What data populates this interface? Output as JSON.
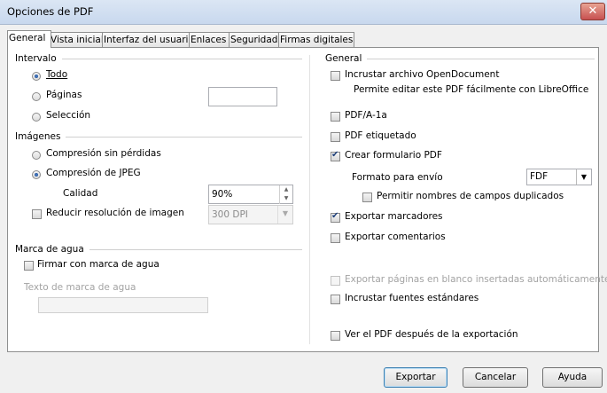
{
  "window": {
    "title": "Opciones de PDF",
    "close": "✕"
  },
  "tabs": [
    "General",
    "Vista inicial",
    "Interfaz del usuario",
    "Enlaces",
    "Seguridad",
    "Firmas digitales"
  ],
  "left": {
    "range": {
      "heading": "Intervalo",
      "all": "Todo",
      "pages": "Páginas",
      "pages_value": "",
      "selection": "Selección",
      "selected": "Todo"
    },
    "images": {
      "heading": "Imágenes",
      "lossless": "Compresión sin pérdidas",
      "jpeg": "Compresión de JPEG",
      "selected": "Compresión de JPEG",
      "quality_label": "Calidad",
      "quality_value": "90%",
      "reduce_label": "Reducir resolución de imagen",
      "reduce_checked": false,
      "resolution_value": "300 DPI"
    },
    "watermark": {
      "heading": "Marca de agua",
      "sign_label": "Firmar con marca de agua",
      "sign_checked": false,
      "text_label": "Texto de marca de agua",
      "text_value": ""
    }
  },
  "right": {
    "heading": "General",
    "embed_od": "Incrustar archivo OpenDocument",
    "embed_od_hint": "Permite editar este PDF fácilmente con LibreOffice",
    "pdfa": "PDF/A-1a",
    "tagged": "PDF etiquetado",
    "create_form": "Crear formulario PDF",
    "submit_format_label": "Formato para envío",
    "submit_format_value": "FDF",
    "allow_duplicates": "Permitir nombres de campos duplicados",
    "export_bookmarks": "Exportar marcadores",
    "export_comments": "Exportar comentarios",
    "export_blank": "Exportar páginas en blanco insertadas automáticamente",
    "embed_fonts": "Incrustar fuentes estándares",
    "view_after": "Ver el PDF después de la exportación",
    "checked": {
      "create_form": true,
      "export_bookmarks": true
    }
  },
  "buttons": {
    "export": "Exportar",
    "cancel": "Cancelar",
    "help": "Ayuda"
  }
}
